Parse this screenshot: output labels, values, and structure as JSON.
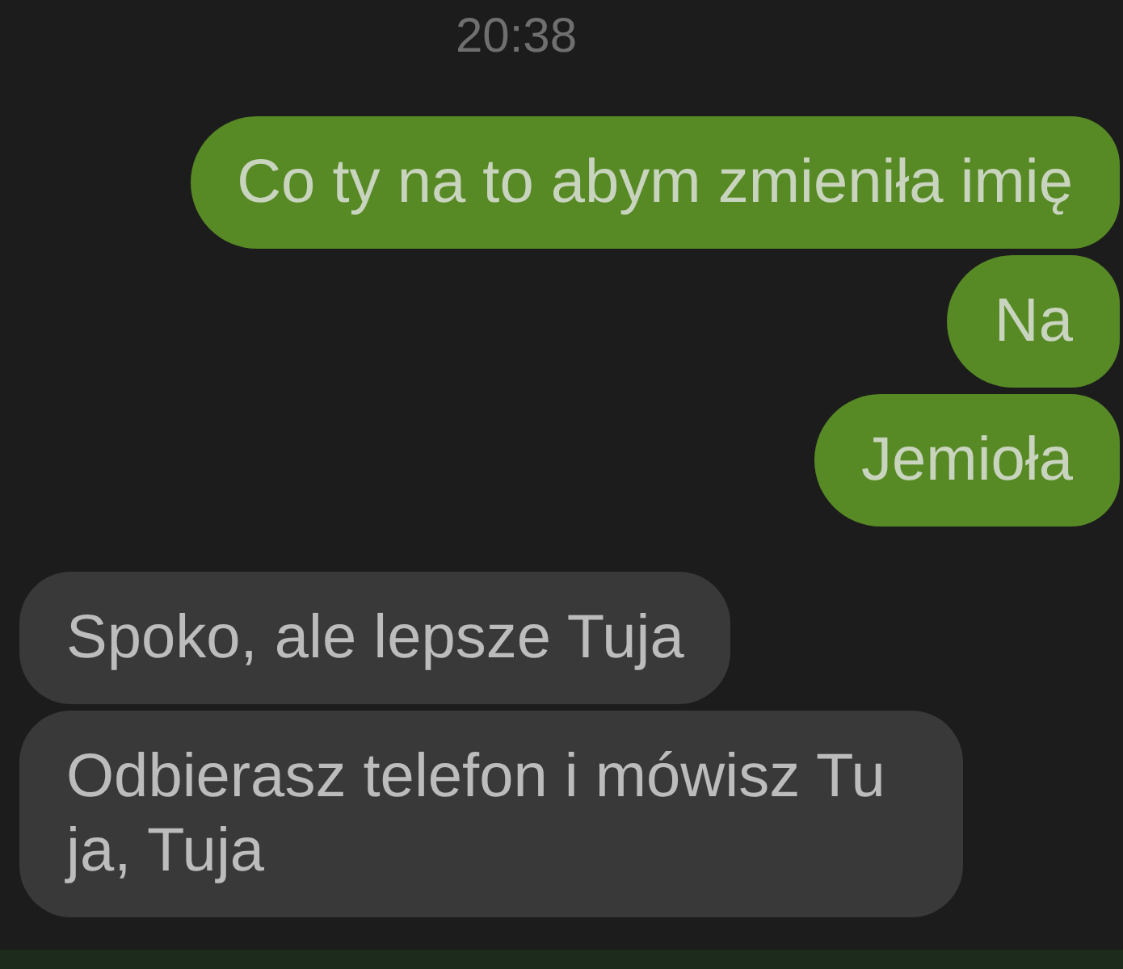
{
  "timestamp": "20:38",
  "messages": [
    {
      "kind": "sent",
      "text": "Co ty na to abym zmieniła imię"
    },
    {
      "kind": "sent",
      "text": "Na"
    },
    {
      "kind": "sent",
      "text": "Jemioła"
    },
    {
      "kind": "received",
      "text": "Spoko, ale lepsze Tuja"
    },
    {
      "kind": "received",
      "text": "Odbierasz telefon i mówisz Tu ja, Tuja"
    }
  ]
}
